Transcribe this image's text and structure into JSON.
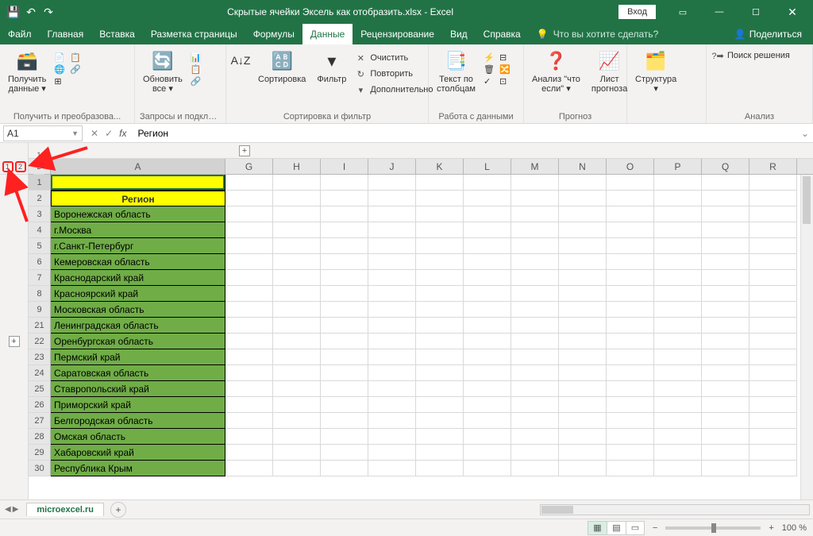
{
  "title": "Скрытые ячейки Эксель как отобразить.xlsx  -  Excel",
  "qat": {
    "login": "Вход"
  },
  "tabs": {
    "file": "Файл",
    "home": "Главная",
    "insert": "Вставка",
    "layout": "Разметка страницы",
    "formulas": "Формулы",
    "data": "Данные",
    "review": "Рецензирование",
    "view": "Вид",
    "help": "Справка",
    "tell": "Что вы хотите сделать?",
    "share": "Поделиться"
  },
  "ribbon": {
    "g1": {
      "getdata": "Получить\nданные ▾",
      "label": "Получить и преобразова..."
    },
    "g2": {
      "refresh": "Обновить\nвсе ▾",
      "label": "Запросы и подключе..."
    },
    "g3": {
      "sort": "Сортировка",
      "filter": "Фильтр",
      "clear": "Очистить",
      "reapply": "Повторить",
      "advanced": "Дополнительно",
      "label": "Сортировка и фильтр"
    },
    "g4": {
      "textcol": "Текст по\nстолбцам",
      "label": "Работа с данными"
    },
    "g5": {
      "whatif": "Анализ \"что\nесли\" ▾",
      "forecast": "Лист\nпрогноза",
      "label": "Прогноз"
    },
    "g6": {
      "outline": "Структура\n▾"
    },
    "g7": {
      "solver": "Поиск решения",
      "label": "Анализ"
    }
  },
  "namebox": "A1",
  "formula": "Регион",
  "columns": [
    "A",
    "G",
    "H",
    "I",
    "J",
    "K",
    "L",
    "M",
    "N",
    "O",
    "P",
    "Q",
    "R"
  ],
  "rows": [
    {
      "n": 1,
      "val": "",
      "cls": "r1 sel"
    },
    {
      "n": 2,
      "val": "Регион",
      "cls": "r2"
    },
    {
      "n": 3,
      "val": "Воронежская область",
      "cls": "green"
    },
    {
      "n": 4,
      "val": "г.Москва",
      "cls": "green"
    },
    {
      "n": 5,
      "val": "г.Санкт-Петербург",
      "cls": "green"
    },
    {
      "n": 6,
      "val": "Кемеровская область",
      "cls": "green"
    },
    {
      "n": 7,
      "val": "Краснодарский край",
      "cls": "green"
    },
    {
      "n": 8,
      "val": "Красноярский край",
      "cls": "green"
    },
    {
      "n": 9,
      "val": "Московская область",
      "cls": "green"
    },
    {
      "n": 21,
      "val": "Ленинградская область",
      "cls": "green"
    },
    {
      "n": 22,
      "val": "Оренбургская область",
      "cls": "green"
    },
    {
      "n": 23,
      "val": "Пермский край",
      "cls": "green"
    },
    {
      "n": 24,
      "val": "Саратовская область",
      "cls": "green"
    },
    {
      "n": 25,
      "val": "Ставропольский край",
      "cls": "green"
    },
    {
      "n": 26,
      "val": "Приморский край",
      "cls": "green"
    },
    {
      "n": 27,
      "val": "Белгородская область",
      "cls": "green"
    },
    {
      "n": 28,
      "val": "Омская область",
      "cls": "green"
    },
    {
      "n": 29,
      "val": "Хабаровский край",
      "cls": "green"
    },
    {
      "n": 30,
      "val": "Республика Крым",
      "cls": "green"
    }
  ],
  "sheet_tab": "microexcel.ru",
  "zoom": "100 %"
}
